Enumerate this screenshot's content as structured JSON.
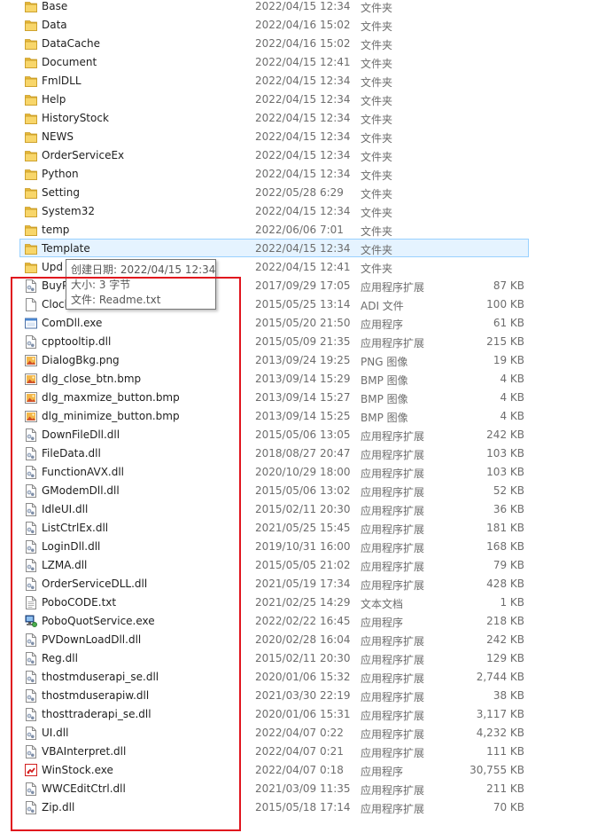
{
  "files": [
    {
      "name": "Base",
      "date": "2022/04/15 12:34",
      "type": "文件夹",
      "size": "",
      "icon": "folder-icon"
    },
    {
      "name": "Data",
      "date": "2022/04/16 15:02",
      "type": "文件夹",
      "size": "",
      "icon": "folder-icon"
    },
    {
      "name": "DataCache",
      "date": "2022/04/16 15:02",
      "type": "文件夹",
      "size": "",
      "icon": "folder-icon"
    },
    {
      "name": "Document",
      "date": "2022/04/15 12:41",
      "type": "文件夹",
      "size": "",
      "icon": "folder-icon"
    },
    {
      "name": "FmlDLL",
      "date": "2022/04/15 12:34",
      "type": "文件夹",
      "size": "",
      "icon": "folder-icon"
    },
    {
      "name": "Help",
      "date": "2022/04/15 12:34",
      "type": "文件夹",
      "size": "",
      "icon": "folder-icon"
    },
    {
      "name": "HistoryStock",
      "date": "2022/04/15 12:34",
      "type": "文件夹",
      "size": "",
      "icon": "folder-icon"
    },
    {
      "name": "NEWS",
      "date": "2022/04/15 12:34",
      "type": "文件夹",
      "size": "",
      "icon": "folder-icon"
    },
    {
      "name": "OrderServiceEx",
      "date": "2022/04/15 12:34",
      "type": "文件夹",
      "size": "",
      "icon": "folder-icon"
    },
    {
      "name": "Python",
      "date": "2022/04/15 12:34",
      "type": "文件夹",
      "size": "",
      "icon": "folder-icon"
    },
    {
      "name": "Setting",
      "date": "2022/05/28 6:29",
      "type": "文件夹",
      "size": "",
      "icon": "folder-icon"
    },
    {
      "name": "System32",
      "date": "2022/04/15 12:34",
      "type": "文件夹",
      "size": "",
      "icon": "folder-icon"
    },
    {
      "name": "temp",
      "date": "2022/06/06 7:01",
      "type": "文件夹",
      "size": "",
      "icon": "folder-icon"
    },
    {
      "name": "Template",
      "date": "2022/04/15 12:34",
      "type": "文件夹",
      "size": "",
      "icon": "folder-icon",
      "selected": true
    },
    {
      "name": "Upd",
      "date": "2022/04/15 12:41",
      "type": "文件夹",
      "size": "",
      "icon": "folder-icon"
    },
    {
      "name": "BuyP",
      "date": "2017/09/29 17:05",
      "type": "应用程序扩展",
      "size": "87 KB",
      "icon": "dll-file-icon"
    },
    {
      "name": "Clock",
      "date": "2015/05/25 13:14",
      "type": "ADI 文件",
      "size": "100 KB",
      "icon": "blank-file-icon"
    },
    {
      "name": "ComDll.exe",
      "date": "2015/05/20 21:50",
      "type": "应用程序",
      "size": "61 KB",
      "icon": "exe-file-icon"
    },
    {
      "name": "cpptooltip.dll",
      "date": "2015/05/09 21:35",
      "type": "应用程序扩展",
      "size": "215 KB",
      "icon": "dll-file-icon"
    },
    {
      "name": "DialogBkg.png",
      "date": "2013/09/24 19:25",
      "type": "PNG 图像",
      "size": "19 KB",
      "icon": "image-file-icon"
    },
    {
      "name": "dlg_close_btn.bmp",
      "date": "2013/09/14 15:29",
      "type": "BMP 图像",
      "size": "4 KB",
      "icon": "image-file-icon"
    },
    {
      "name": "dlg_maxmize_button.bmp",
      "date": "2013/09/14 15:27",
      "type": "BMP 图像",
      "size": "4 KB",
      "icon": "image-file-icon"
    },
    {
      "name": "dlg_minimize_button.bmp",
      "date": "2013/09/14 15:25",
      "type": "BMP 图像",
      "size": "4 KB",
      "icon": "image-file-icon"
    },
    {
      "name": "DownFileDll.dll",
      "date": "2015/05/06 13:05",
      "type": "应用程序扩展",
      "size": "242 KB",
      "icon": "dll-file-icon"
    },
    {
      "name": "FileData.dll",
      "date": "2018/08/27 20:47",
      "type": "应用程序扩展",
      "size": "103 KB",
      "icon": "dll-file-icon"
    },
    {
      "name": "FunctionAVX.dll",
      "date": "2020/10/29 18:00",
      "type": "应用程序扩展",
      "size": "103 KB",
      "icon": "dll-file-icon"
    },
    {
      "name": "GModemDll.dll",
      "date": "2015/05/06 13:02",
      "type": "应用程序扩展",
      "size": "52 KB",
      "icon": "dll-file-icon"
    },
    {
      "name": "IdleUI.dll",
      "date": "2015/02/11 20:30",
      "type": "应用程序扩展",
      "size": "36 KB",
      "icon": "dll-file-icon"
    },
    {
      "name": "ListCtrlEx.dll",
      "date": "2021/05/25 15:45",
      "type": "应用程序扩展",
      "size": "181 KB",
      "icon": "dll-file-icon"
    },
    {
      "name": "LoginDll.dll",
      "date": "2019/10/31 16:00",
      "type": "应用程序扩展",
      "size": "168 KB",
      "icon": "dll-file-icon"
    },
    {
      "name": "LZMA.dll",
      "date": "2015/05/05 21:02",
      "type": "应用程序扩展",
      "size": "79 KB",
      "icon": "dll-file-icon"
    },
    {
      "name": "OrderServiceDLL.dll",
      "date": "2021/05/19 17:34",
      "type": "应用程序扩展",
      "size": "428 KB",
      "icon": "dll-file-icon"
    },
    {
      "name": "PoboCODE.txt",
      "date": "2021/02/25 14:29",
      "type": "文本文档",
      "size": "1 KB",
      "icon": "text-file-icon"
    },
    {
      "name": "PoboQuotService.exe",
      "date": "2022/02/22 16:45",
      "type": "应用程序",
      "size": "218 KB",
      "icon": "service-exe-icon"
    },
    {
      "name": "PVDownLoadDll.dll",
      "date": "2020/02/28 16:04",
      "type": "应用程序扩展",
      "size": "242 KB",
      "icon": "dll-file-icon"
    },
    {
      "name": "Reg.dll",
      "date": "2015/02/11 20:30",
      "type": "应用程序扩展",
      "size": "129 KB",
      "icon": "dll-file-icon"
    },
    {
      "name": "thostmduserapi_se.dll",
      "date": "2020/01/06 15:32",
      "type": "应用程序扩展",
      "size": "2,744 KB",
      "icon": "dll-file-icon"
    },
    {
      "name": "thostmduserapiw.dll",
      "date": "2021/03/30 22:19",
      "type": "应用程序扩展",
      "size": "38 KB",
      "icon": "dll-file-icon"
    },
    {
      "name": "thosttraderapi_se.dll",
      "date": "2020/01/06 15:31",
      "type": "应用程序扩展",
      "size": "3,117 KB",
      "icon": "dll-file-icon"
    },
    {
      "name": "UI.dll",
      "date": "2022/04/07 0:22",
      "type": "应用程序扩展",
      "size": "4,232 KB",
      "icon": "dll-file-icon"
    },
    {
      "name": "VBAInterpret.dll",
      "date": "2022/04/07 0:21",
      "type": "应用程序扩展",
      "size": "111 KB",
      "icon": "dll-file-icon"
    },
    {
      "name": "WinStock.exe",
      "date": "2022/04/07 0:18",
      "type": "应用程序",
      "size": "30,755 KB",
      "icon": "winstock-app-icon"
    },
    {
      "name": "WWCEditCtrl.dll",
      "date": "2021/03/09 11:35",
      "type": "应用程序扩展",
      "size": "211 KB",
      "icon": "dll-file-icon"
    },
    {
      "name": "Zip.dll",
      "date": "2015/05/18 17:14",
      "type": "应用程序扩展",
      "size": "70 KB",
      "icon": "dll-file-icon"
    }
  ],
  "tooltip": {
    "created": "创建日期: 2022/04/15 12:34",
    "size": "大小: 3 字节",
    "files": "文件: Readme.txt"
  },
  "highlight_color": "#e0141e",
  "selection_color": "#e5f3ff"
}
